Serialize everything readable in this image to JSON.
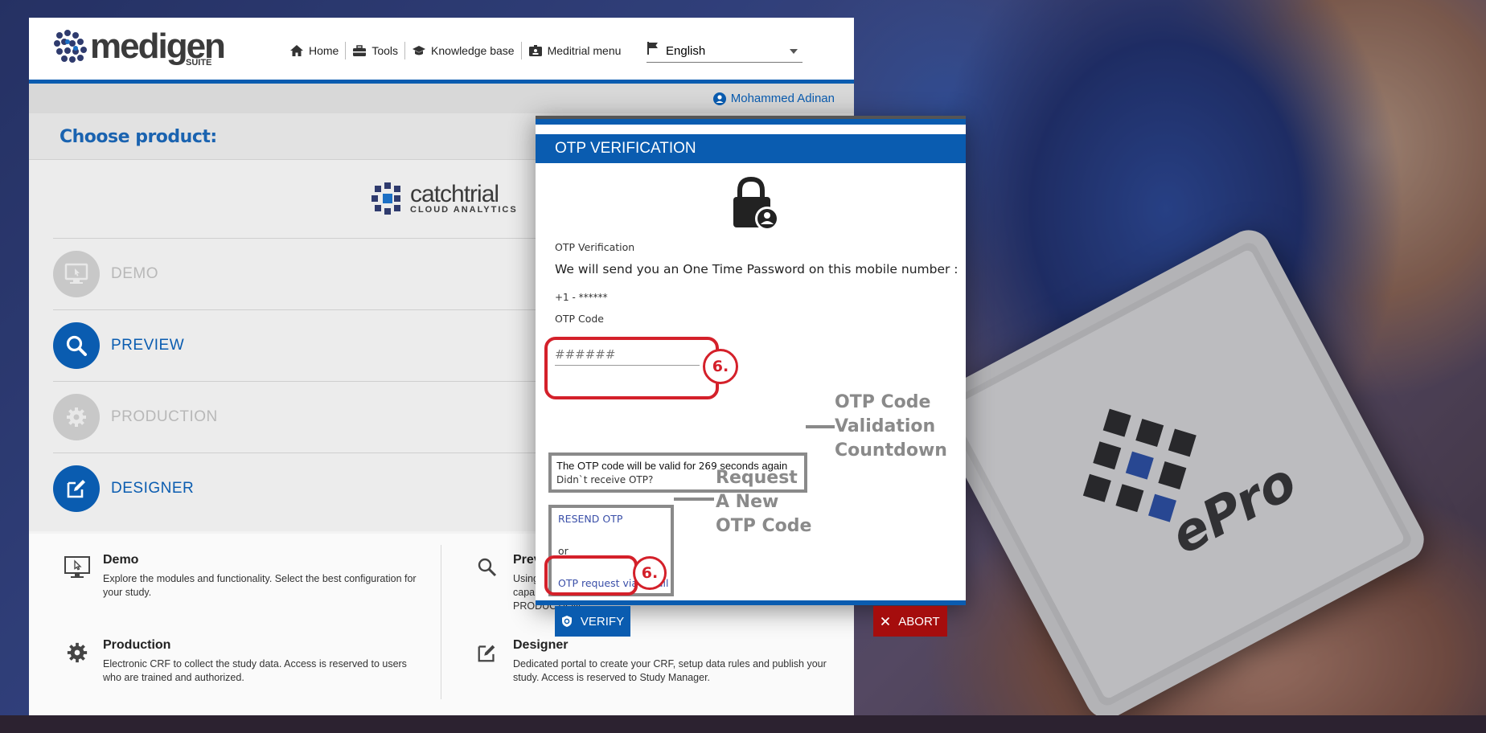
{
  "header": {
    "logo_text": "medigen",
    "logo_suite": "SUITE",
    "nav": [
      {
        "label": "Home",
        "icon": "home-icon"
      },
      {
        "label": "Tools",
        "icon": "toolbox-icon"
      },
      {
        "label": "Knowledge base",
        "icon": "graduation-cap-icon"
      },
      {
        "label": "Meditrial menu",
        "icon": "badge-icon"
      }
    ],
    "language": {
      "selected": "English",
      "icon": "flag-icon"
    }
  },
  "user": {
    "name": "Mohammed Adinan"
  },
  "choose": {
    "title": "Choose product:"
  },
  "catchtrial": {
    "name": "catchtrial",
    "sub": "CLOUD ANALYTICS"
  },
  "products": [
    {
      "label": "DEMO",
      "state": "disabled"
    },
    {
      "label": "PREVIEW",
      "state": "active"
    },
    {
      "label": "PRODUCTION",
      "state": "disabled"
    },
    {
      "label": "DESIGNER",
      "state": "active"
    }
  ],
  "info": [
    {
      "title": "Demo",
      "desc": "Explore the modules and functionality. Select the best configuration for your study."
    },
    {
      "title": "Prev",
      "desc": "Using capa PRODUCTION."
    },
    {
      "title": "Production",
      "desc": "Electronic CRF to collect the study data. Access is reserved to users who are trained and authorized."
    },
    {
      "title": "Designer",
      "desc": "Dedicated portal to create your CRF, setup data rules and publish your study. Access is reserved to Study Manager."
    }
  ],
  "modal": {
    "title": "OTP VERIFICATION",
    "subtitle": "OTP Verification",
    "message": "We will send you an One Time Password on this mobile number :",
    "phone": "+1 - ******",
    "code_label": "OTP Code",
    "code_placeholder": "######",
    "countdown_prefix": "The OTP code will be valid for",
    "countdown_value": "269",
    "countdown_suffix": "seconds again",
    "didnt_receive": "Didn`t receive OTP?",
    "resend": "RESEND OTP",
    "or": "or",
    "email_request": "OTP request via email",
    "verify": "VERIFY",
    "abort": "ABORT"
  },
  "annotations": {
    "step_badge": "6.",
    "countdown_note": [
      "OTP Code",
      "Validation",
      "Countdown"
    ],
    "resend_note": [
      "Request",
      "A New",
      "OTP Code"
    ]
  },
  "background": {
    "tablet_text": "ePro"
  },
  "colors": {
    "brand_blue": "#0a5cb0",
    "abort_red": "#a50d0d",
    "annotation_red": "#d4202a",
    "annotation_gray": "#8a8a8a"
  }
}
